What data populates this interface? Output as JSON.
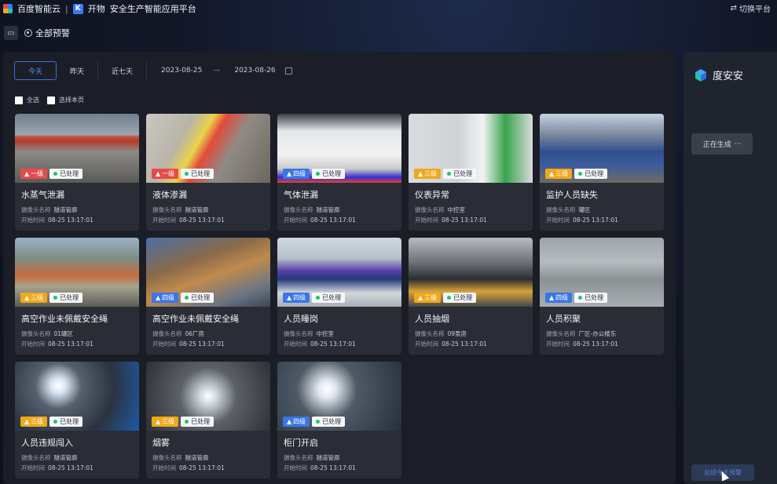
{
  "header": {
    "brand": "百度智能云",
    "separator": "|",
    "k_letter": "K",
    "product": "开物",
    "platform": "安全生产智能应用平台",
    "switch_label": "切换平台"
  },
  "subbar": {
    "title": "全部预警"
  },
  "filter": {
    "tabs": [
      "今天",
      "昨天",
      "近七天"
    ],
    "active_tab": "今天",
    "start_date": "2023-08-25",
    "date_separator": "—",
    "end_date": "2023-08-26"
  },
  "checks": {
    "select_all": "全选",
    "select_page": "选择本页"
  },
  "status_label": "已处理",
  "cards": [
    {
      "level": "一级",
      "color": "red",
      "title": "水蒸气泄漏",
      "camera_label": "摄像头名称",
      "camera": "隧道管廊",
      "time_label": "开始时间",
      "time": "08-25 13:17:01"
    },
    {
      "level": "一级",
      "color": "red",
      "title": "液体渗漏",
      "camera_label": "摄像头名称",
      "camera": "隧道管廊",
      "time_label": "开始时间",
      "time": "08-25 13:17:01"
    },
    {
      "level": "四级",
      "color": "blue",
      "title": "气体泄漏",
      "camera_label": "摄像头名称",
      "camera": "隧道管廊",
      "time_label": "开始时间",
      "time": "08-25 13:17:01"
    },
    {
      "level": "三级",
      "color": "yellow",
      "title": "仪表异常",
      "camera_label": "摄像头名称",
      "camera": "中控室",
      "time_label": "开始时间",
      "time": "08-25 13:17:01"
    },
    {
      "level": "三级",
      "color": "yellow",
      "title": "监护人员缺失",
      "camera_label": "摄像头名称",
      "camera": "罐区",
      "time_label": "开始时间",
      "time": "08-25 13:17:01"
    },
    {
      "level": "三级",
      "color": "yellow",
      "title": "高空作业未佩戴安全绳",
      "camera_label": "摄像头名称",
      "camera": "01罐区",
      "time_label": "开始时间",
      "time": "08-25 13:17:01"
    },
    {
      "level": "四级",
      "color": "blue",
      "title": "高空作业未佩戴安全绳",
      "camera_label": "摄像头名称",
      "camera": "06厂房",
      "time_label": "开始时间",
      "time": "08-25 13:17:01"
    },
    {
      "level": "四级",
      "color": "blue",
      "title": "人员睡岗",
      "camera_label": "摄像头名称",
      "camera": "中控室",
      "time_label": "开始时间",
      "time": "08-25 13:17:01"
    },
    {
      "level": "三级",
      "color": "yellow",
      "title": "人员抽烟",
      "camera_label": "摄像头名称",
      "camera": "09泵房",
      "time_label": "开始时间",
      "time": "08-25 13:17:01"
    },
    {
      "level": "四级",
      "color": "blue",
      "title": "人员积聚",
      "camera_label": "摄像头名称",
      "camera": "厂区-办公楼东",
      "time_label": "开始时间",
      "time": "08-25 13:17:01"
    },
    {
      "level": "三级",
      "color": "yellow",
      "title": "人员违规闯入",
      "camera_label": "摄像头名称",
      "camera": "隧道管廊",
      "time_label": "开始时间",
      "time": "08-25 13:17:01"
    },
    {
      "level": "三级",
      "color": "yellow",
      "title": "烟雾",
      "camera_label": "摄像头名称",
      "camera": "隧道管廊",
      "time_label": "开始时间",
      "time": "08-25 13:17:01"
    },
    {
      "level": "四级",
      "color": "blue",
      "title": "柜门开启",
      "camera_label": "摄像头名称",
      "camera": "隧道管廊",
      "time_label": "开始时间",
      "time": "08-25 13:17:01"
    }
  ],
  "side": {
    "brand": "度安安",
    "generate_label": "正在生成",
    "generate_suffix": "···",
    "bottom_button": "总结今天预警"
  }
}
